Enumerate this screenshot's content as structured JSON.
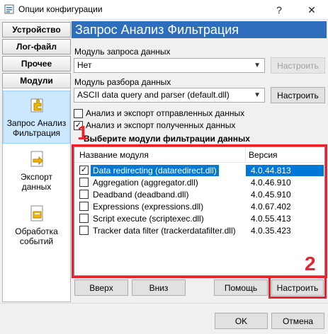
{
  "window": {
    "title": "Опции конфигурации",
    "help": "?",
    "close": "✕"
  },
  "nav": {
    "tabs": [
      "Устройство",
      "Лог-файл",
      "Прочее",
      "Модули"
    ],
    "items": [
      {
        "label_line1": "Запрос Анализ",
        "label_line2": "Фильтрация",
        "icon": "puzzle-icon"
      },
      {
        "label_line1": "Экспорт",
        "label_line2": "данных",
        "icon": "export-icon"
      },
      {
        "label_line1": "Обработка",
        "label_line2": "событий",
        "icon": "events-icon"
      }
    ]
  },
  "header": {
    "title": "Запрос Анализ Фильтрация"
  },
  "query_module": {
    "label": "Модуль запроса данных",
    "value": "Нет",
    "configure": "Настроить"
  },
  "parse_module": {
    "label": "Модуль разбора данных",
    "value": "ASCII data query and parser (default.dll)",
    "configure": "Настроить"
  },
  "options": {
    "sent": {
      "label": "Анализ и экспорт отправленных данных",
      "checked": false
    },
    "received": {
      "label": "Анализ и экспорт полученных данных",
      "checked": true
    }
  },
  "filter": {
    "heading": "Выберите модули фильтрации данных",
    "col_name": "Название модуля",
    "col_version": "Версия",
    "rows": [
      {
        "name": "Data redirecting (dataredirect.dll)",
        "version": "4.0.44.813",
        "checked": true,
        "selected": true
      },
      {
        "name": "Aggregation (aggregator.dll)",
        "version": "4.0.46.910",
        "checked": false,
        "selected": false
      },
      {
        "name": "Deadband (deadband.dll)",
        "version": "4.0.45.910",
        "checked": false,
        "selected": false
      },
      {
        "name": "Expressions (expressions.dll)",
        "version": "4.0.67.402",
        "checked": false,
        "selected": false
      },
      {
        "name": "Script execute (scriptexec.dll)",
        "version": "4.0.55.413",
        "checked": false,
        "selected": false
      },
      {
        "name": "Tracker data filter (trackerdatafilter.dll)",
        "version": "4.0.35.423",
        "checked": false,
        "selected": false
      }
    ]
  },
  "buttons": {
    "up": "Вверх",
    "down": "Вниз",
    "help": "Помощь",
    "configure": "Настроить",
    "ok": "OK",
    "cancel": "Отмена"
  },
  "markers": {
    "one": "1",
    "two": "2"
  },
  "colors": {
    "header_bg": "#2f6ebd",
    "selection": "#0078d7",
    "annotation_red": "#e8232b"
  }
}
